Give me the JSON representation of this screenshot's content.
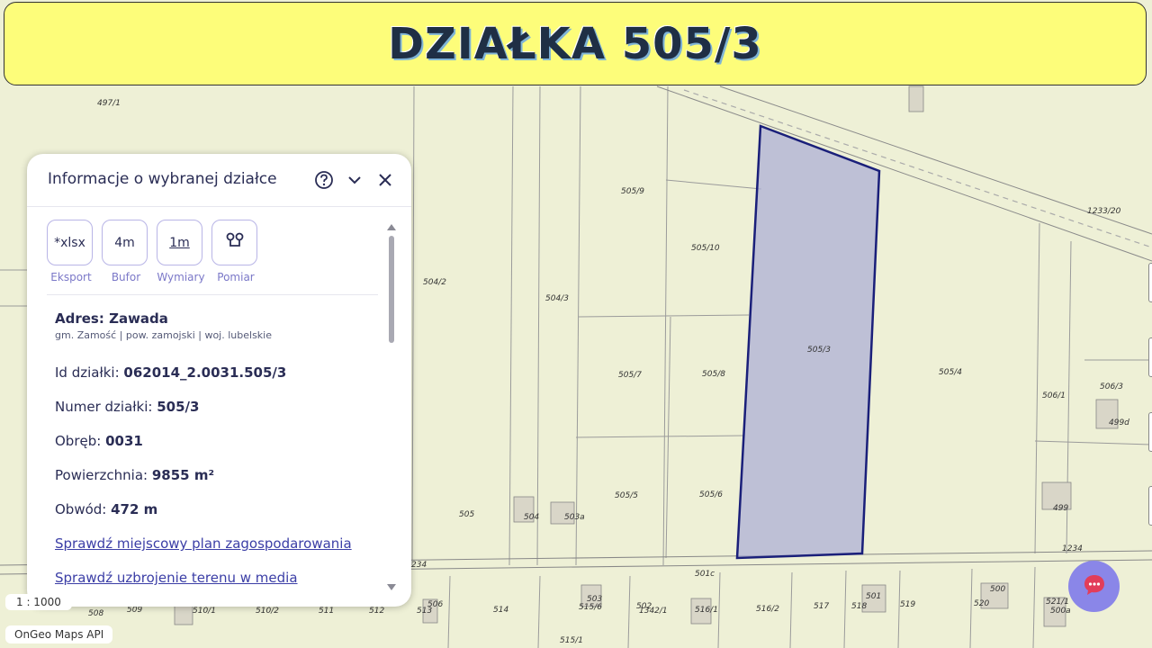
{
  "banner": {
    "title": "DZIAŁKA 505/3"
  },
  "panel": {
    "title": "Informacje o wybranej działce",
    "header_icons": [
      "help-icon",
      "chevron-down-icon",
      "close-icon"
    ],
    "tools": [
      {
        "icon_text": "*xlsx",
        "label": "Eksport"
      },
      {
        "icon_text": "4m",
        "label": "Bufor"
      },
      {
        "icon_text": "1m",
        "label": "Wymiary"
      },
      {
        "icon_text": "",
        "label": "Pomiar"
      }
    ],
    "address_title": "Adres: Zawada",
    "address_sub": "gm. Zamość | pow. zamojski | woj. lubelskie",
    "rows": [
      {
        "label": "Id działki: ",
        "value": "062014_2.0031.505/3"
      },
      {
        "label": "Numer działki: ",
        "value": "505/3"
      },
      {
        "label": "Obręb: ",
        "value": "0031"
      },
      {
        "label": "Powierzchnia: ",
        "value": "9855 m²"
      },
      {
        "label": "Obwód: ",
        "value": "472 m"
      }
    ],
    "links": [
      "Sprawdź miejscowy plan zagospodarowania",
      "Sprawdź uzbrojenie terenu w media"
    ]
  },
  "map": {
    "scale": "1 : 1000",
    "credit": "OnGeo Maps API",
    "highlight_color": "#1a1f7a",
    "parcel_labels": [
      "497/1",
      "505/9",
      "505/10",
      "504/2",
      "504/3",
      "505/3",
      "505/7",
      "505/8",
      "505/4",
      "506/1",
      "506/3",
      "499d",
      "505/5",
      "505/6",
      "505",
      "504",
      "503a",
      "499",
      "1233/20",
      "1234",
      "234",
      "501c",
      "506",
      "503",
      "510/1",
      "510/2",
      "511",
      "512",
      "513",
      "514",
      "515/6",
      "502",
      "1342/1",
      "516/1",
      "516/2",
      "517",
      "518",
      "501",
      "519",
      "500",
      "520",
      "521/1",
      "500a",
      "508",
      "509",
      "515/1"
    ]
  }
}
